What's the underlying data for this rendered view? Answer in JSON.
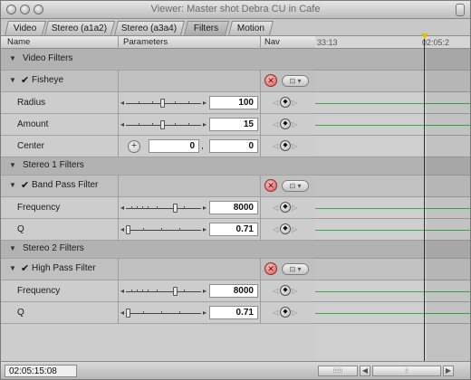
{
  "window": {
    "title": "Viewer: Master shot Debra CU in Cafe"
  },
  "tabs": [
    {
      "label": "Video"
    },
    {
      "label": "Stereo (a1a2)"
    },
    {
      "label": "Stereo (a3a4)"
    },
    {
      "label": "Filters"
    },
    {
      "label": "Motion"
    }
  ],
  "active_tab": "Filters",
  "columns": {
    "name": "Name",
    "parameters": "Parameters",
    "nav": "Nav"
  },
  "timeline": {
    "tc_left": "33:13",
    "tc_right": "02:05:2"
  },
  "sections": {
    "video_filters": "Video Filters",
    "fisheye": "Fisheye",
    "stereo1": "Stereo 1 Filters",
    "band_pass": "Band Pass Filter",
    "stereo2": "Stereo 2 Filters",
    "high_pass": "High Pass Filter"
  },
  "params": {
    "radius": {
      "label": "Radius",
      "value": "100"
    },
    "amount": {
      "label": "Amount",
      "value": "15"
    },
    "center": {
      "label": "Center",
      "x": "0",
      "separator": ",",
      "y": "0"
    },
    "bp_frequency": {
      "label": "Frequency",
      "value": "8000"
    },
    "bp_q": {
      "label": "Q",
      "value": "0.71"
    },
    "hp_frequency": {
      "label": "Frequency",
      "value": "8000"
    },
    "hp_q": {
      "label": "Q",
      "value": "0.71"
    }
  },
  "footer": {
    "timecode": "02:05:15:08"
  }
}
